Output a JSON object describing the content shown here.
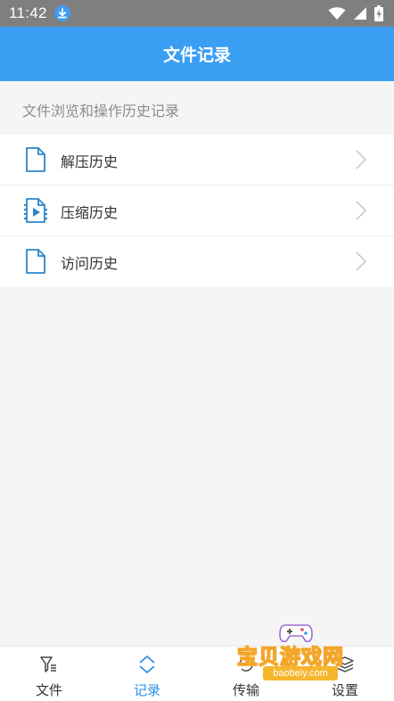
{
  "status_bar": {
    "time": "11:42",
    "icons": [
      "download-notification-icon",
      "wifi-icon",
      "signal-icon",
      "battery-charging-icon"
    ]
  },
  "header": {
    "title": "文件记录"
  },
  "section": {
    "caption": "文件浏览和操作历史记录"
  },
  "records": [
    {
      "label": "解压历史",
      "icon": "document-icon"
    },
    {
      "label": "压缩历史",
      "icon": "video-file-icon"
    },
    {
      "label": "访问历史",
      "icon": "document-icon"
    }
  ],
  "bottom_nav": {
    "active": "记录",
    "tabs": [
      {
        "label": "文件",
        "icon": "file-filter-icon"
      },
      {
        "label": "记录",
        "icon": "record-arrows-icon"
      },
      {
        "label": "传输",
        "icon": "transfer-icon"
      },
      {
        "label": "设置",
        "icon": "settings-layers-icon"
      }
    ]
  },
  "watermark": {
    "text": "宝贝游戏网",
    "url": "baobeiy.com"
  },
  "colors": {
    "primary": "#3a9ff3",
    "active_tab": "#2c8fe6",
    "icon_blue": "#2a86c9",
    "status_bar": "#7f7f7f"
  }
}
